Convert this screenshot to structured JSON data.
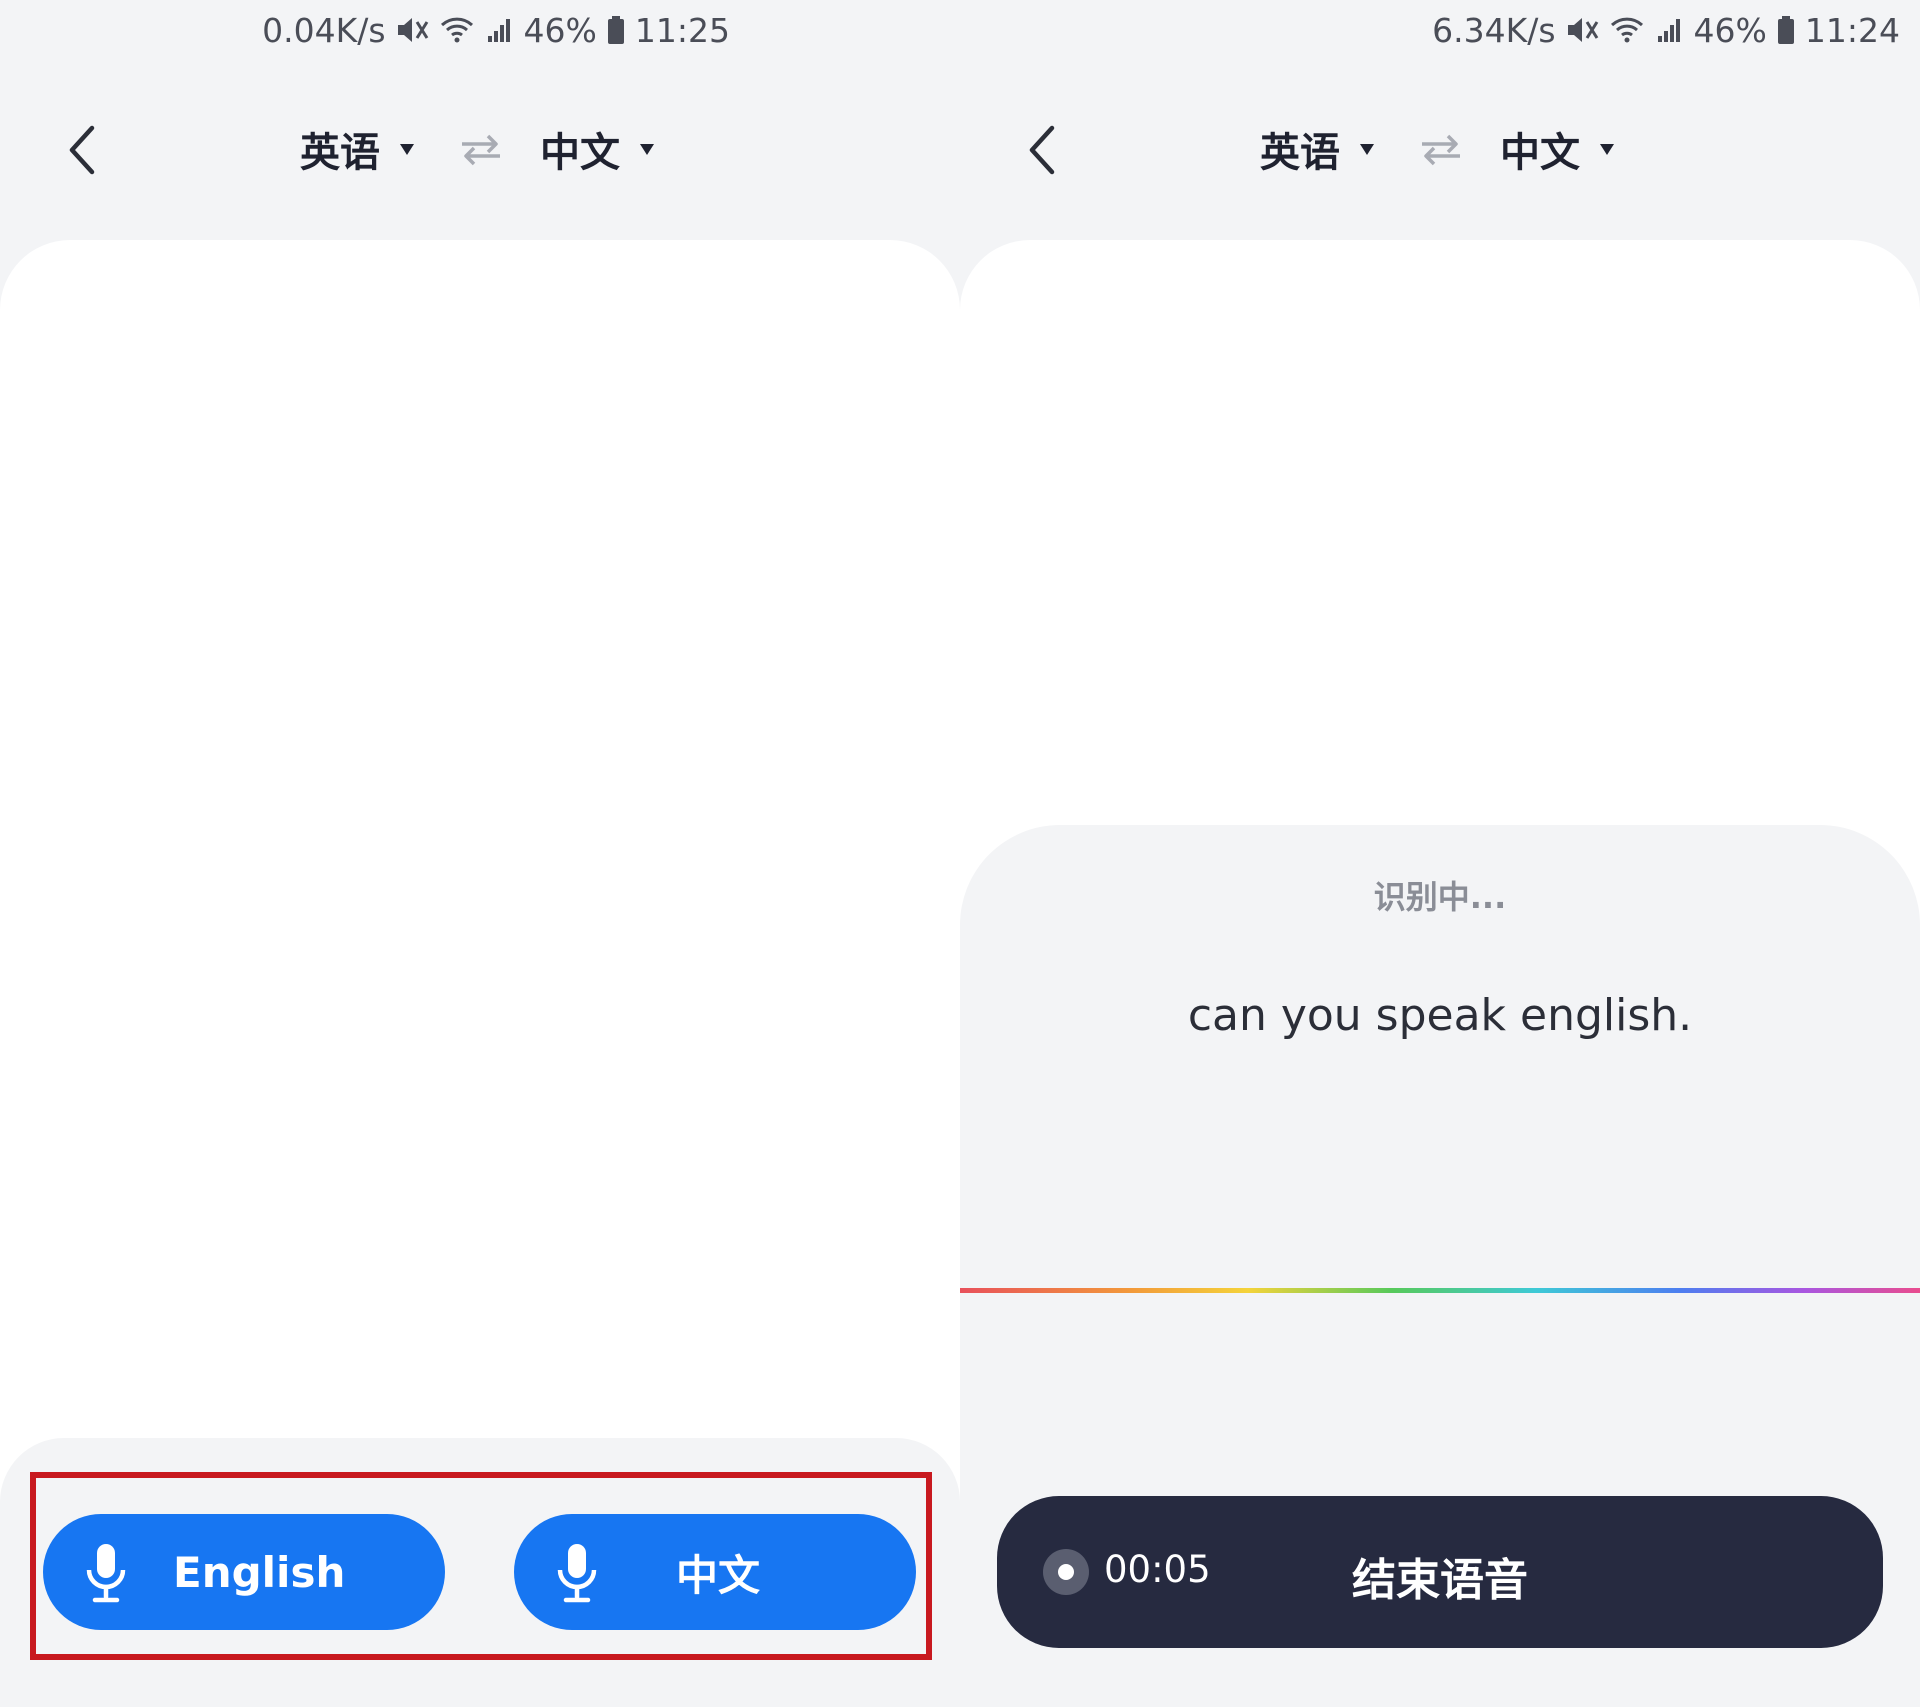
{
  "left_screen": {
    "status_bar": {
      "net_speed": "0.04K/s",
      "battery": "46%",
      "time": "11:25"
    },
    "header": {
      "source_lang": "英语",
      "target_lang": "中文"
    },
    "buttons": {
      "english_label": "English",
      "chinese_label": "中文"
    }
  },
  "right_screen": {
    "status_bar": {
      "net_speed": "6.34K/s",
      "battery": "46%",
      "time": "11:24"
    },
    "header": {
      "source_lang": "英语",
      "target_lang": "中文"
    },
    "recognition": {
      "status": "识别中...",
      "text": "can you speak english."
    },
    "recorder": {
      "elapsed": "00:05",
      "stop_label": "结束语音"
    }
  },
  "colors": {
    "accent_blue": "#1776f2",
    "stop_bar": "#262a40",
    "highlight_red": "#c8191f",
    "background": "#f3f4f6"
  },
  "icons": [
    "back-icon",
    "swap-icon",
    "mute-icon",
    "wifi-icon",
    "signal-icon",
    "battery-icon",
    "microphone-icon",
    "record-dot-icon"
  ]
}
